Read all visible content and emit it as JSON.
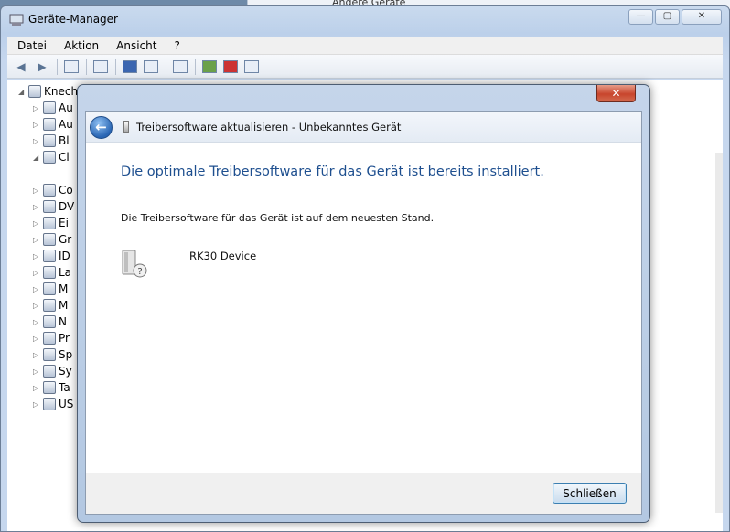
{
  "background_window": {
    "lines": [
      "Andere Geräte",
      "Audio-, Video- und Gamecontroller"
    ]
  },
  "device_manager": {
    "title": "Geräte-Manager",
    "menu": [
      "Datei",
      "Aktion",
      "Ansicht",
      "?"
    ],
    "caption_buttons": {
      "minimize": "—",
      "maximize": "▢",
      "close": "✕"
    },
    "tree": {
      "root": "Knech",
      "items": [
        "Au",
        "Au",
        "Bl",
        "Cl",
        "Co",
        "DV",
        "Ei",
        "Gr",
        "ID",
        "La",
        "M",
        "M",
        "N",
        "Pr",
        "Sp",
        "Sy",
        "Ta",
        "US"
      ]
    }
  },
  "dialog": {
    "close_glyph": "✕",
    "back_glyph": "←",
    "header_title": "Treibersoftware aktualisieren - Unbekanntes Gerät",
    "main_instruction": "Die optimale Treibersoftware für das Gerät ist bereits installiert.",
    "body_text": "Die Treibersoftware für das Gerät ist auf dem neuesten Stand.",
    "device_name": "RK30 Device",
    "close_button": "Schließen"
  },
  "colors": {
    "instruction_blue": "#1e4f8f",
    "close_red": "#c8452c"
  }
}
